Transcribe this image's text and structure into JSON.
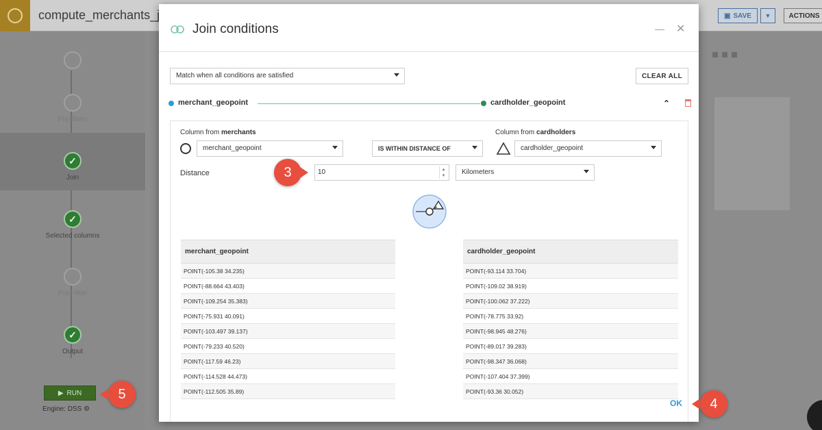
{
  "app": {
    "recipe_title": "compute_merchants_j",
    "save_label": "SAVE",
    "actions_label": "ACTIONS"
  },
  "sidebar": {
    "steps": [
      {
        "label": "",
        "state": "empty"
      },
      {
        "label": "Pre-filters",
        "state": "empty"
      },
      {
        "label": "Join",
        "state": "done"
      },
      {
        "label": "Selected columns",
        "state": "done"
      },
      {
        "label": "Post-filter",
        "state": "empty"
      },
      {
        "label": "Output",
        "state": "done"
      }
    ],
    "run_label": "RUN",
    "engine_label": "Engine: DSS"
  },
  "modal": {
    "title": "Join conditions",
    "match_mode": "Match when all conditions are satisfied",
    "clear_all": "CLEAR ALL",
    "left_key": "merchant_geopoint",
    "right_key": "cardholder_geopoint",
    "condition": {
      "left_prefix": "Column from ",
      "left_dataset": "merchants",
      "right_prefix": "Column from ",
      "right_dataset": "cardholders",
      "left_column": "merchant_geopoint",
      "operator": "IS WITHIN DISTANCE OF",
      "right_column": "cardholder_geopoint",
      "distance_label": "Distance",
      "distance_value": "10",
      "distance_unit": "Kilometers"
    },
    "left_table": {
      "header": "merchant_geopoint",
      "rows": [
        "POINT(-105.38 34.235)",
        "POINT(-88.664 43.403)",
        "POINT(-109.254 35.383)",
        "POINT(-75.931 40.091)",
        "POINT(-103.497 39.137)",
        "POINT(-79.233 40.520)",
        "POINT(-117.59 46.23)",
        "POINT(-114.528 44.473)",
        "POINT(-112.505 35.89)"
      ]
    },
    "right_table": {
      "header": "cardholder_geopoint",
      "rows": [
        "POINT(-93.114 33.704)",
        "POINT(-109.02 38.919)",
        "POINT(-100.062 37.222)",
        "POINT(-78.775 33.92)",
        "POINT(-98.945 48.276)",
        "POINT(-89.017 39.283)",
        "POINT(-98.347 36.068)",
        "POINT(-107.404 37.399)",
        "POINT(-93.36 30.052)"
      ]
    },
    "ok_label": "OK"
  },
  "callouts": {
    "distance_step": "3",
    "ok_step": "4",
    "run_step": "5"
  },
  "colors": {
    "callout": "#e84e3d",
    "accent": "#2a9fd6",
    "done_step": "#2e7d32",
    "run_button": "#3c6a25"
  }
}
